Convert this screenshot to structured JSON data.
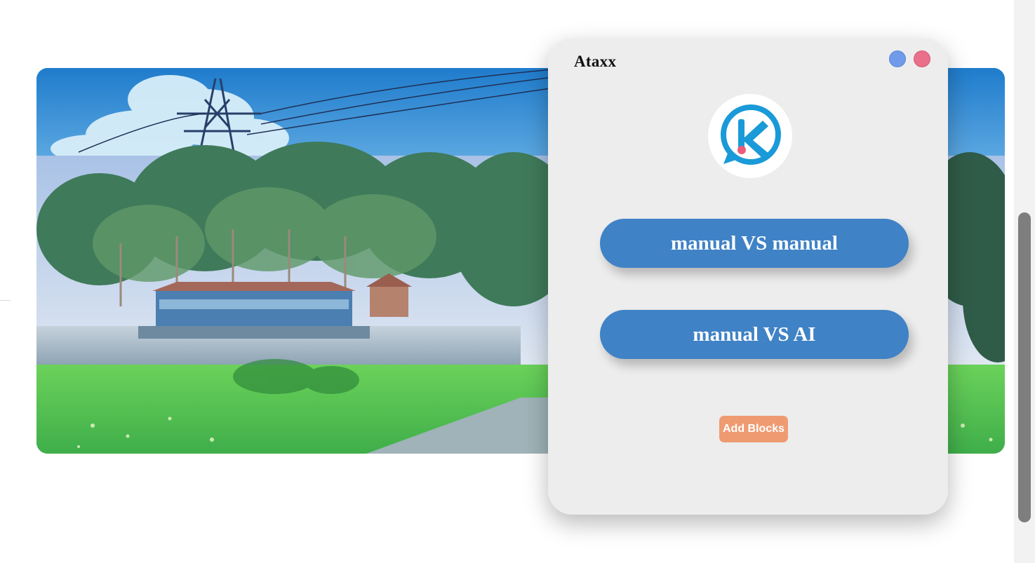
{
  "window": {
    "title": "Ataxx"
  },
  "controls": {
    "minimize_icon": "blue-circle-icon",
    "close_icon": "pink-circle-icon"
  },
  "logo": {
    "icon": "k-chat-logo-icon"
  },
  "menu": {
    "manual_vs_manual": "manual VS manual",
    "manual_vs_ai": "manual VS AI",
    "add_blocks": "Add Blocks"
  },
  "colors": {
    "button_blue": "#3f82c6",
    "add_blocks_orange": "#ef9b72",
    "panel_background": "#ededed",
    "minimize_dot": "#6f9bea",
    "close_dot": "#ea6f8a"
  }
}
